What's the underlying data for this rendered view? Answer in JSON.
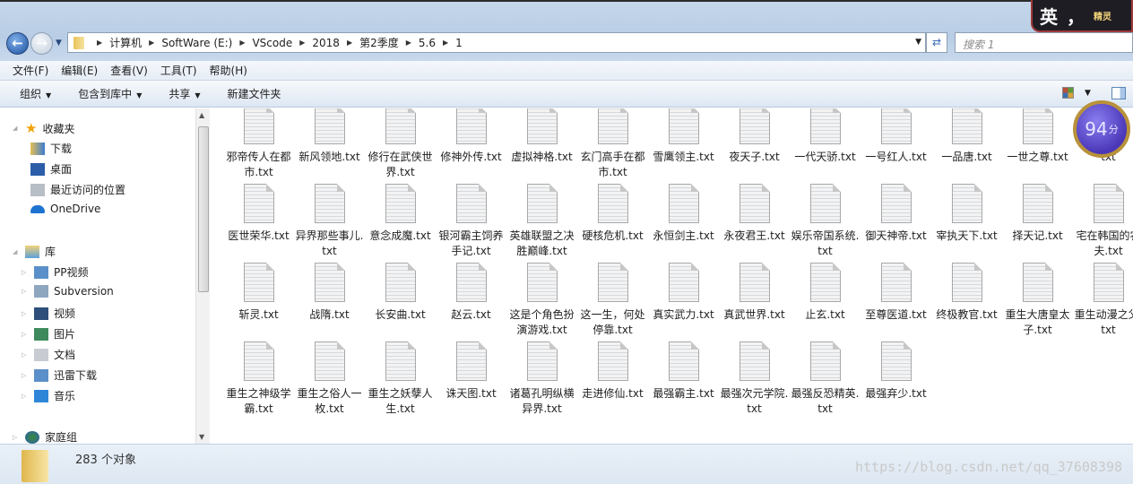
{
  "window": {
    "ime_label": "英",
    "ime_punct": "，",
    "ime_extra": "精灵"
  },
  "nav": {
    "breadcrumb": [
      "计算机",
      "SoftWare (E:)",
      "VScode",
      "2018",
      "第2季度",
      "5.6",
      "1"
    ],
    "search_placeholder": "搜索 1"
  },
  "menu": [
    "文件(F)",
    "编辑(E)",
    "查看(V)",
    "工具(T)",
    "帮助(H)"
  ],
  "toolbar": {
    "organize": "组织",
    "include_library": "包含到库中",
    "share": "共享",
    "new_folder": "新建文件夹"
  },
  "sidebar": {
    "favorites": "收藏夹",
    "downloads": "下载",
    "desktop": "桌面",
    "recent": "最近访问的位置",
    "onedrive": "OneDrive",
    "libraries": "库",
    "lib_items": [
      "PP视频",
      "Subversion",
      "视频",
      "图片",
      "文档",
      "迅雷下载",
      "音乐"
    ],
    "homegroup": "家庭组"
  },
  "files": [
    "邪帝传人在都市.txt",
    "新风领地.txt",
    "修行在武侠世界.txt",
    "修神外传.txt",
    "虚拟神格.txt",
    "玄门高手在都市.txt",
    "雪鹰领主.txt",
    "夜天子.txt",
    "一代天骄.txt",
    "一号红人.txt",
    "一品唐.txt",
    "一世之尊.txt",
    "txt",
    "医世荣华.txt",
    "异界那些事儿.txt",
    "意念成魔.txt",
    "银河霸主饲养手记.txt",
    "英雄联盟之决胜巅峰.txt",
    "硬核危机.txt",
    "永恒剑主.txt",
    "永夜君王.txt",
    "娱乐帝国系统.txt",
    "御天神帝.txt",
    "宰执天下.txt",
    "择天记.txt",
    "宅在韩国的农夫.txt",
    "斩灵.txt",
    "战隋.txt",
    "长安曲.txt",
    "赵云.txt",
    "这是个角色扮演游戏.txt",
    "这一生，何处停靠.txt",
    "真实武力.txt",
    "真武世界.txt",
    "止玄.txt",
    "至尊医道.txt",
    "终极教官.txt",
    "重生大唐皇太子.txt",
    "重生动漫之父.txt",
    "重生之神级学霸.txt",
    "重生之俗人一枚.txt",
    "重生之妖孽人生.txt",
    "诛天图.txt",
    "诸葛孔明纵横异界.txt",
    "走进修仙.txt",
    "最强霸主.txt",
    "最强次元学院.txt",
    "最强反恐精英.txt",
    "最强弃少.txt"
  ],
  "status": {
    "count": "283 个对象"
  },
  "overlay": {
    "score": "94",
    "score_unit": "分",
    "watermark": "https://blog.csdn.net/qq_37608398"
  }
}
